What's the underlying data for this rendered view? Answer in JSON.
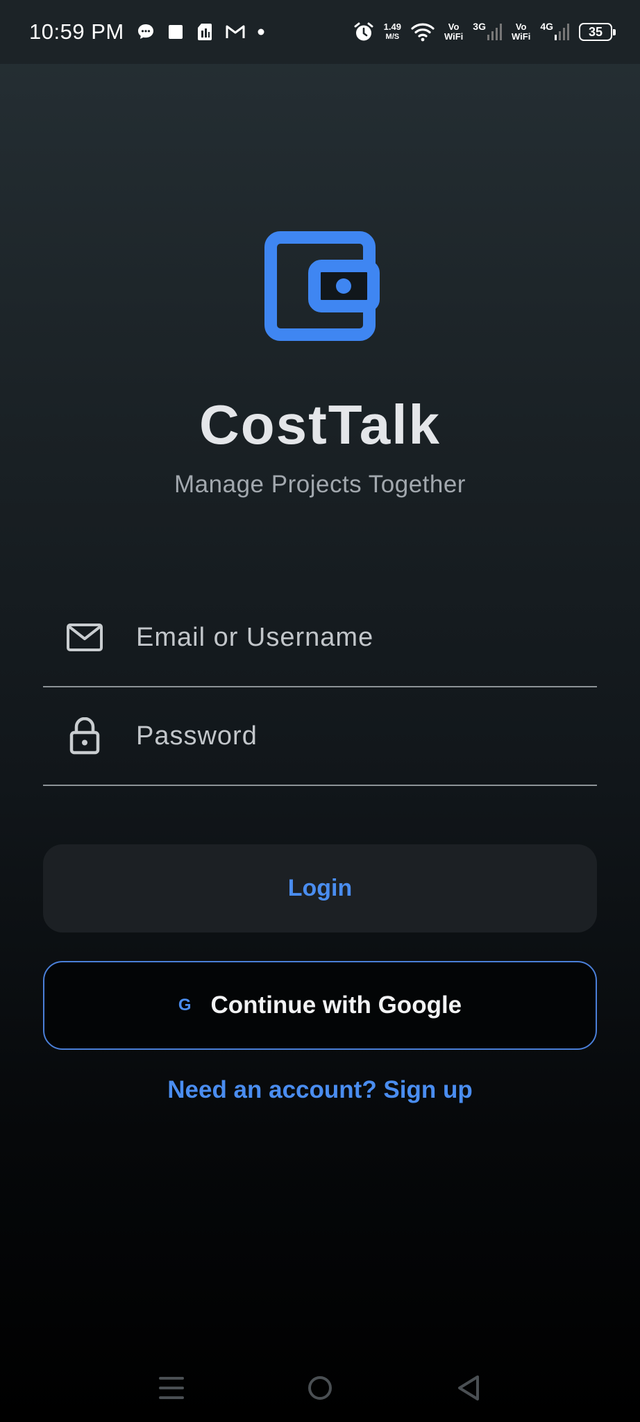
{
  "status_bar": {
    "time": "10:59 PM",
    "speed_value": "1.49",
    "speed_unit": "M/S",
    "sim1_vo": "Vo",
    "sim1_wifi": "WiFi",
    "sim1_gen": "3G",
    "sim2_vo": "Vo",
    "sim2_wifi": "WiFi",
    "sim2_gen": "4G",
    "battery": "35"
  },
  "app": {
    "title": "CostTalk",
    "subtitle": "Manage Projects Together",
    "brand_color": "#4a8df0"
  },
  "form": {
    "email_placeholder": "Email or Username",
    "email_value": "",
    "password_placeholder": "Password",
    "password_value": ""
  },
  "actions": {
    "login_label": "Login",
    "google_icon_letter": "G",
    "google_label": "Continue with Google",
    "signup_label": "Need an account? Sign up"
  },
  "nav": {
    "icons": [
      "menu-icon",
      "home-circle-icon",
      "back-triangle-icon"
    ]
  }
}
